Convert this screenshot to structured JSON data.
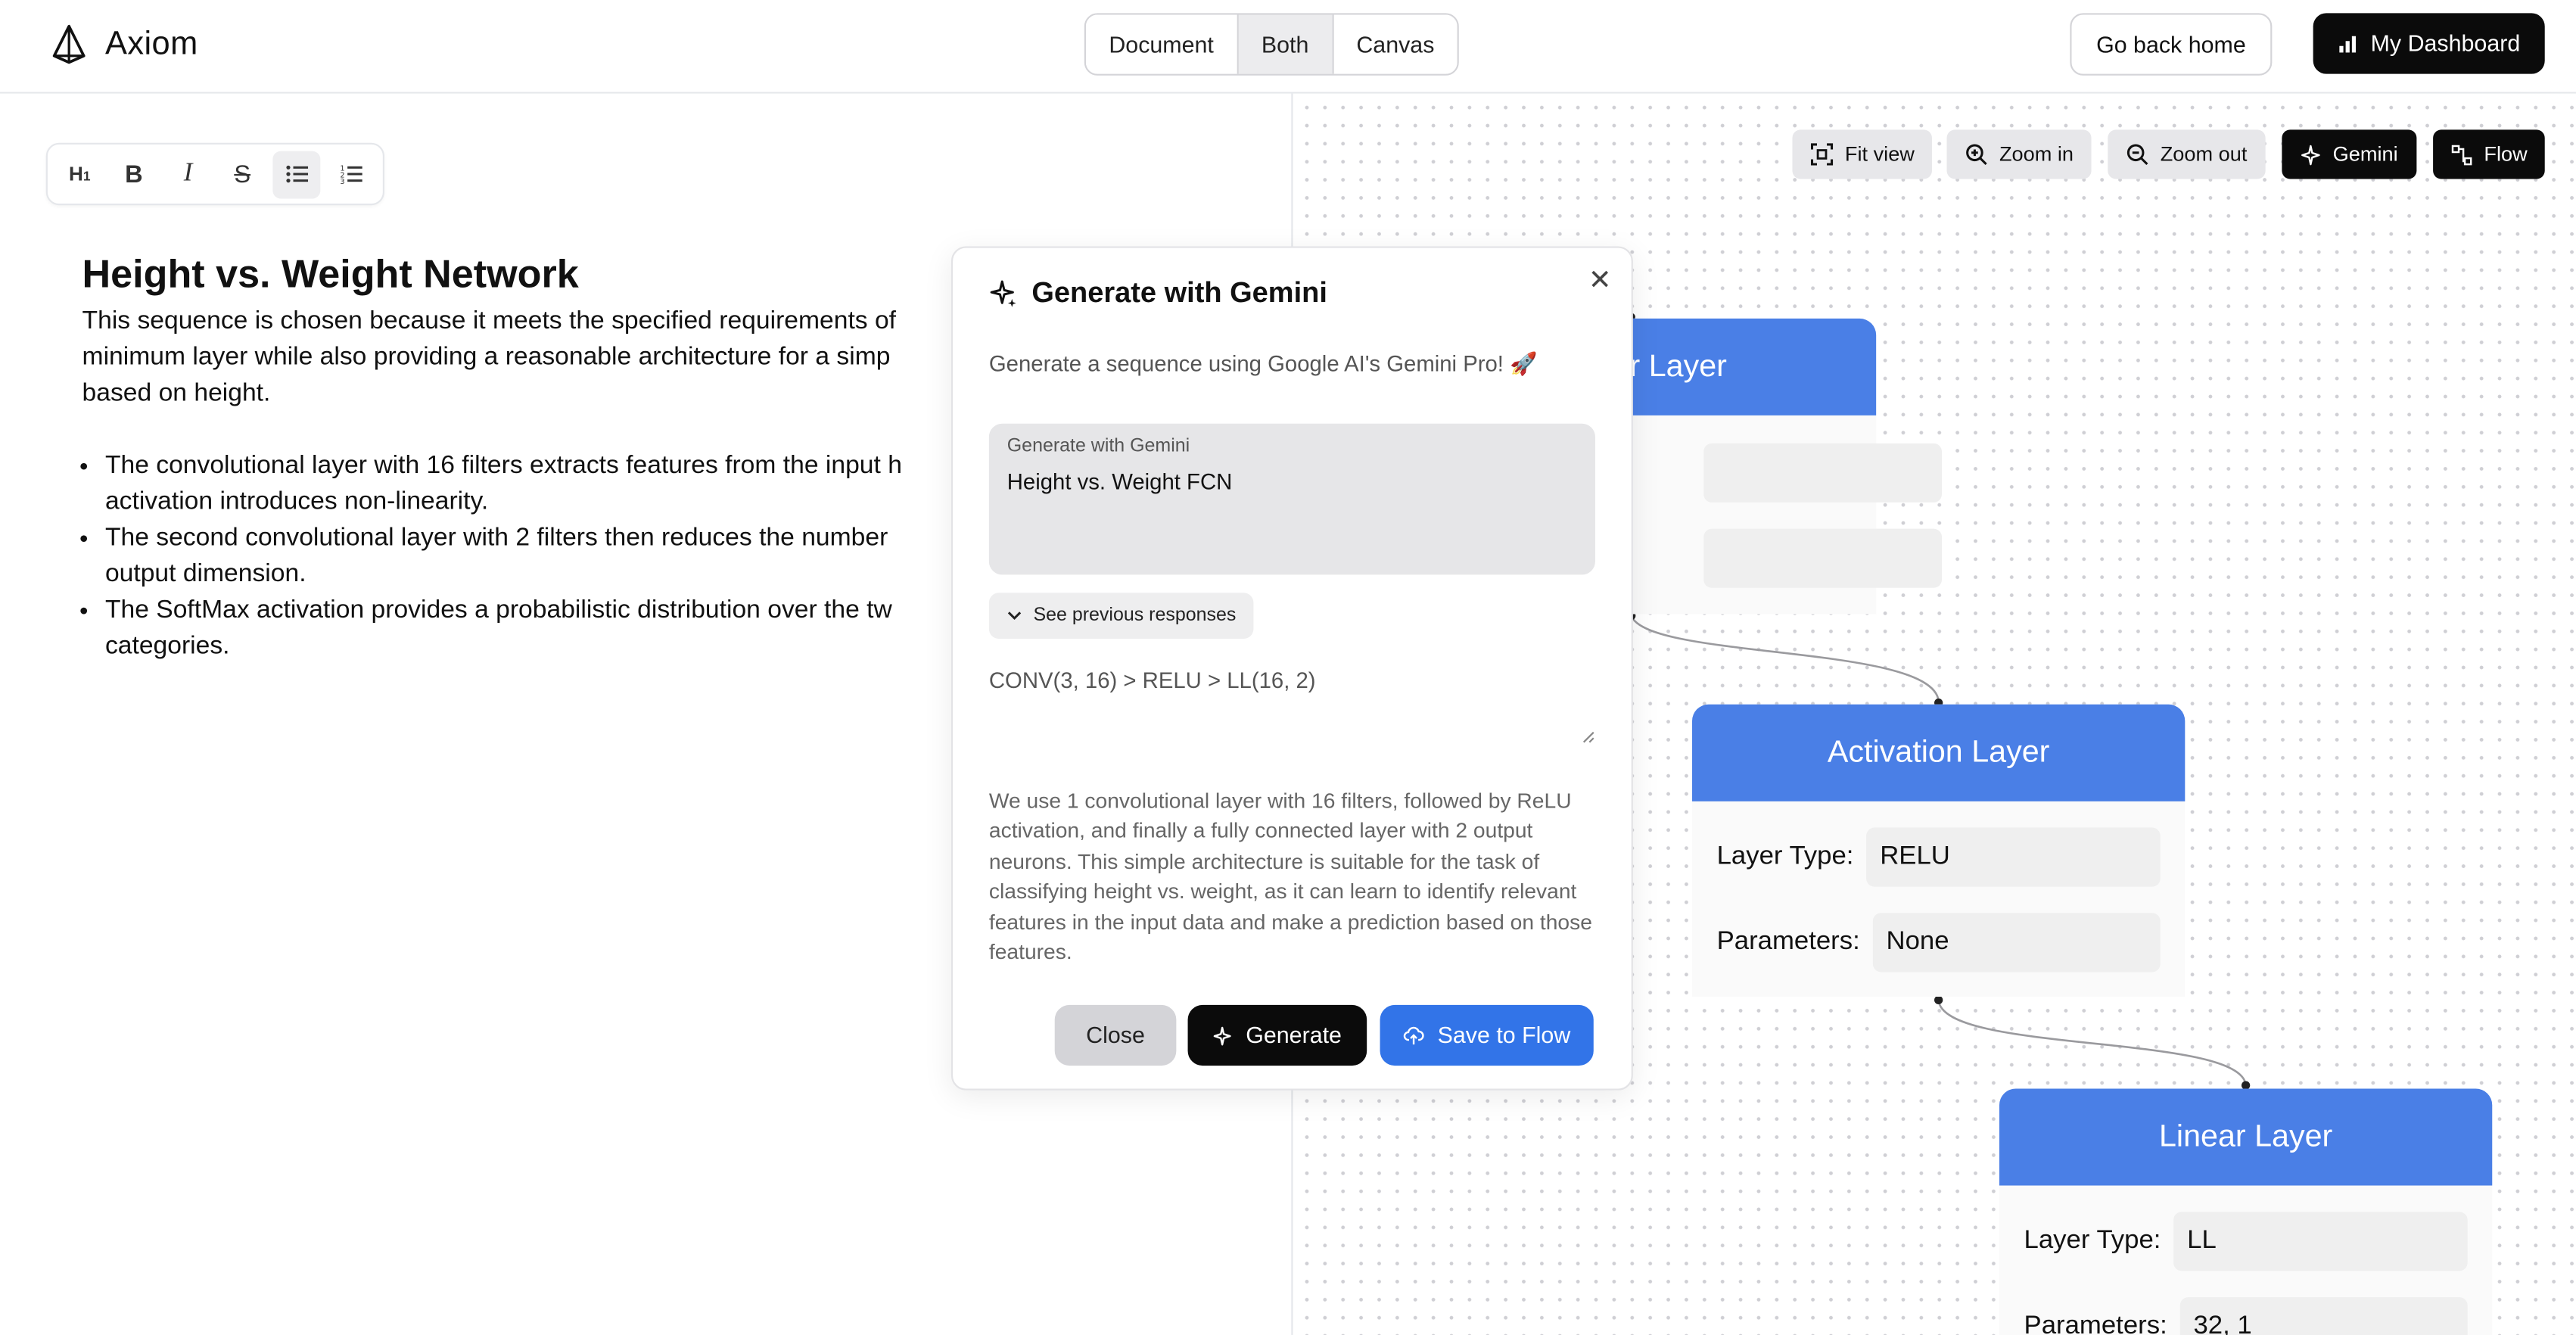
{
  "header": {
    "brand": "Axiom",
    "view_tabs": [
      "Document",
      "Both",
      "Canvas"
    ],
    "active_tab": "Both",
    "go_back_label": "Go back home",
    "dashboard_label": "My Dashboard"
  },
  "editor": {
    "toolbar": [
      {
        "icon": "heading-icon",
        "glyph": "H₁"
      },
      {
        "icon": "bold-icon",
        "glyph": "B"
      },
      {
        "icon": "italic-icon",
        "glyph": "I"
      },
      {
        "icon": "strikethrough-icon",
        "glyph": "S"
      },
      {
        "icon": "bullet-list-icon",
        "glyph": ""
      },
      {
        "icon": "ordered-list-icon",
        "glyph": ""
      }
    ],
    "title": "Height vs. Weight Network",
    "paragraph": "This sequence is chosen because it meets the specified requirements of\nminimum layer while also providing a reasonable architecture for a simp\nbased on height.",
    "bullets": [
      "The convolutional layer with 16 filters extracts features from the input h\nactivation introduces non-linearity.",
      "The second convolutional layer with 2 filters then reduces the number\noutput dimension.",
      "The SoftMax activation provides a probabilistic distribution over the tw\ncategories."
    ]
  },
  "canvas_toolbar": {
    "fit_view": "Fit view",
    "zoom_in": "Zoom in",
    "zoom_out": "Zoom out",
    "gemini": "Gemini",
    "flow": "Flow"
  },
  "nodes": [
    {
      "title": "r Layer",
      "rows": []
    },
    {
      "title": "Activation Layer",
      "rows": [
        {
          "label": "Layer Type:",
          "value": "RELU"
        },
        {
          "label": "Parameters:",
          "value": "None"
        }
      ]
    },
    {
      "title": "Linear Layer",
      "rows": [
        {
          "label": "Layer Type:",
          "value": "LL"
        },
        {
          "label": "Parameters:",
          "value": "32, 1"
        }
      ]
    }
  ],
  "modal": {
    "title": "Generate with Gemini",
    "subtitle": "Generate a sequence using Google AI's Gemini Pro! 🚀",
    "prompt_label": "Generate with Gemini",
    "prompt_value": "Height vs. Weight FCN",
    "previous_label": "See previous responses",
    "sequence": "CONV(3, 16) > RELU > LL(16, 2)",
    "explanation": "We use 1 convolutional layer with 16 filters, followed by ReLU activation, and finally a fully connected layer with 2 output neurons. This simple architecture is suitable for the task of classifying height vs. weight, as it can learn to identify relevant features in the input data and make a prediction based on those features.",
    "close_label": "Close",
    "generate_label": "Generate",
    "save_label": "Save to Flow"
  },
  "colors": {
    "accent_blue": "#3274e8",
    "node_header": "#4a7fe6",
    "dark_button": "#0b0b0b"
  }
}
